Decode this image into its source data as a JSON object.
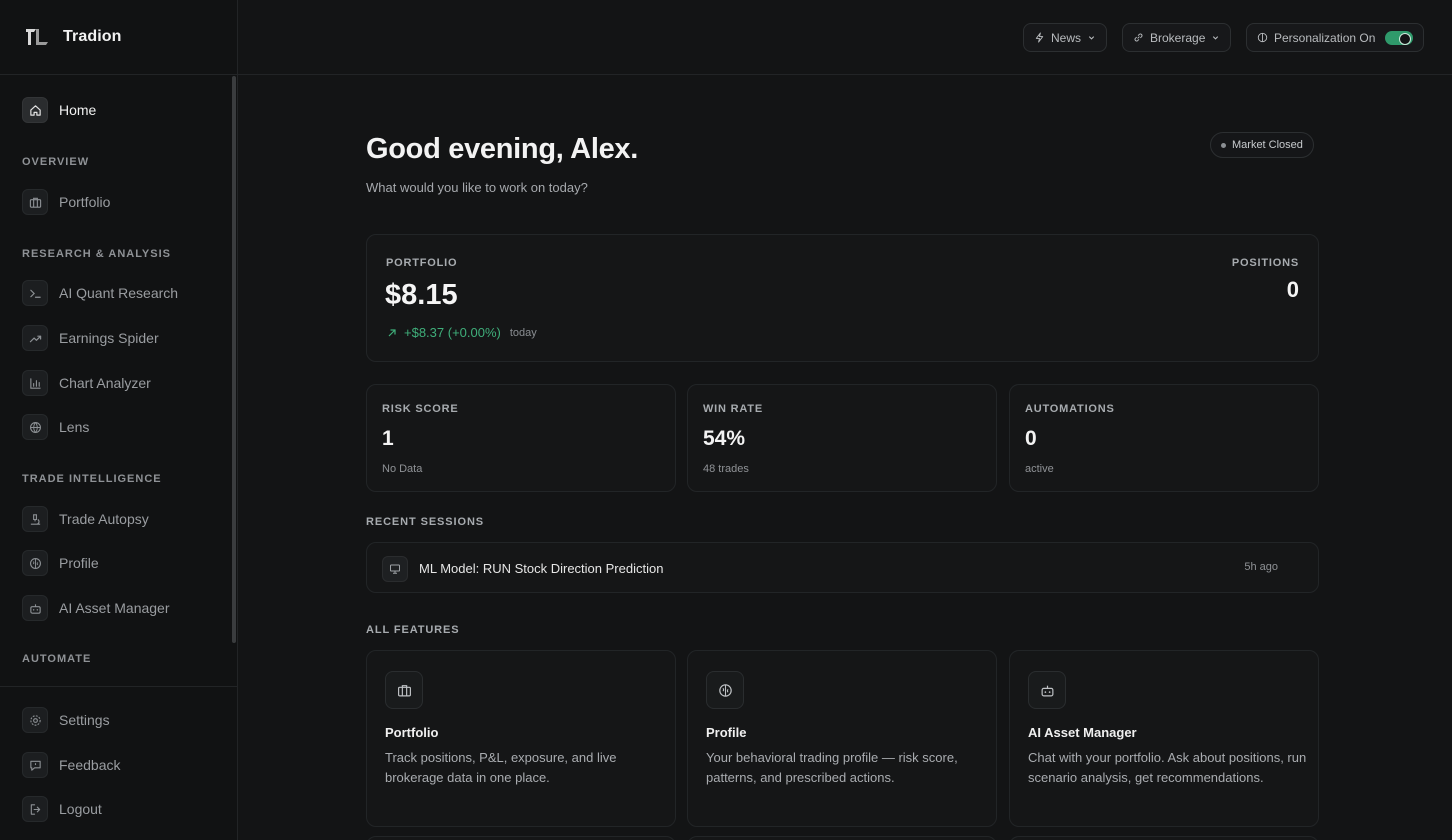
{
  "brand": {
    "name": "Tradion",
    "logo_icon": "tradion-logo"
  },
  "topbar": {
    "news_label": "News",
    "brokerage_label": "Brokerage",
    "personalization_label": "Personalization On",
    "personalization_on": true,
    "toggle_color": "#2f9a6b"
  },
  "sidebar": {
    "home": "Home",
    "sections": {
      "overview": "OVERVIEW",
      "research": "RESEARCH & ANALYSIS",
      "trade": "TRADE INTELLIGENCE",
      "automate": "AUTOMATE"
    },
    "items": {
      "portfolio": "Portfolio",
      "quant": "AI Quant Research",
      "earnings": "Earnings Spider",
      "chart": "Chart Analyzer",
      "lens": "Lens",
      "autopsy": "Trade Autopsy",
      "profile": "Profile",
      "asset_manager": "AI Asset Manager"
    },
    "bottom": {
      "settings": "Settings",
      "feedback": "Feedback",
      "logout": "Logout"
    }
  },
  "main": {
    "greeting": "Good evening, Alex.",
    "subtitle": "What would you like to work on today?",
    "market_status": "Market Closed",
    "portfolio": {
      "label": "PORTFOLIO",
      "value": "$8.15",
      "change": "+$8.37 (+0.00%)",
      "change_period": "today",
      "positions_label": "POSITIONS",
      "positions_value": "0",
      "up_color": "#3fae7a"
    },
    "stats": {
      "risk": {
        "label": "RISK SCORE",
        "value": "1",
        "sub": "No Data"
      },
      "winrate": {
        "label": "WIN RATE",
        "value": "54%",
        "sub": "48 trades"
      },
      "automations": {
        "label": "AUTOMATIONS",
        "value": "0",
        "sub": "active"
      }
    },
    "recent_heading": "RECENT SESSIONS",
    "session": {
      "title": "ML Model: RUN Stock Direction Prediction",
      "time": "5h ago"
    },
    "features_heading": "ALL FEATURES",
    "features": [
      {
        "title": "Portfolio",
        "desc": "Track positions, P&L, exposure, and live brokerage data in one place.",
        "icon": "briefcase-icon"
      },
      {
        "title": "Profile",
        "desc": "Your behavioral trading profile — risk score, patterns, and prescribed actions.",
        "icon": "brain-icon"
      },
      {
        "title": "AI Asset Manager",
        "desc": "Chat with your portfolio. Ask about positions, run scenario analysis, get recommendations.",
        "icon": "robot-icon"
      }
    ]
  }
}
